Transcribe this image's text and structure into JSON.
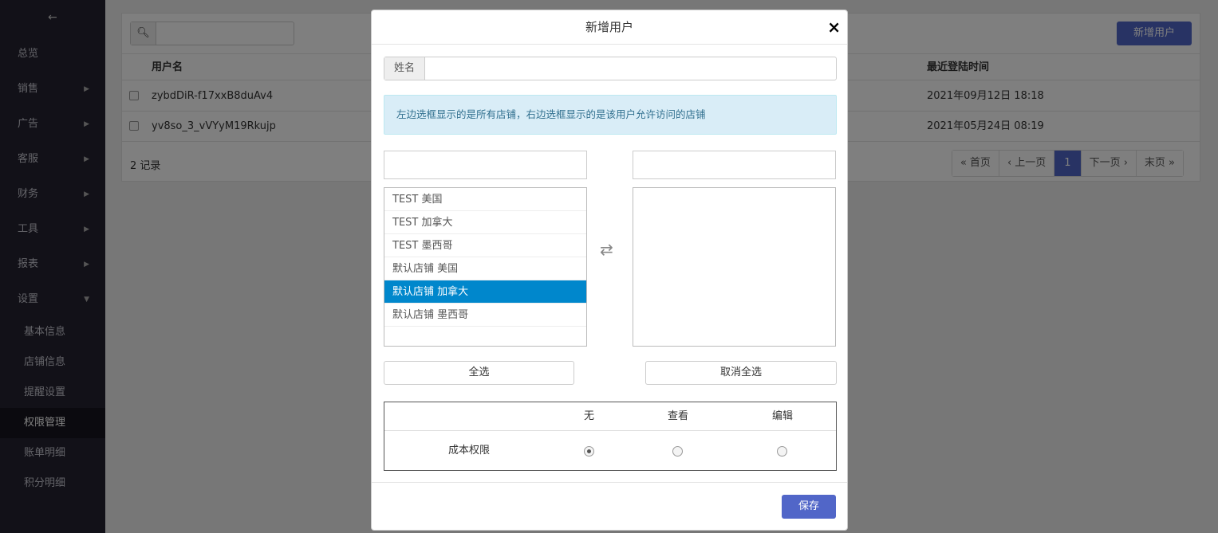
{
  "sidebar": {
    "items": [
      {
        "label": "总览",
        "has_chevron": false
      },
      {
        "label": "销售",
        "has_chevron": true
      },
      {
        "label": "广告",
        "has_chevron": true
      },
      {
        "label": "客服",
        "has_chevron": true
      },
      {
        "label": "财务",
        "has_chevron": true
      },
      {
        "label": "工具",
        "has_chevron": true
      },
      {
        "label": "报表",
        "has_chevron": true
      },
      {
        "label": "设置",
        "has_chevron": true,
        "expanded": true
      }
    ],
    "sub_items": [
      {
        "label": "基本信息"
      },
      {
        "label": "店铺信息"
      },
      {
        "label": "提醒设置"
      },
      {
        "label": "权限管理",
        "active": true
      },
      {
        "label": "账单明细"
      },
      {
        "label": "积分明细"
      }
    ]
  },
  "main": {
    "add_user_label": "新增用户",
    "table": {
      "headers": {
        "username": "用户名",
        "last_login": "最近登陆时间"
      },
      "rows": [
        {
          "username": "zybdDiR-f17xxB8duAv4",
          "last_login": "2021年09月12日 18:18"
        },
        {
          "username": "yv8so_3_vVYyM19Rkujp",
          "last_login": "2021年05月24日 08:19"
        }
      ]
    },
    "records_label": "2 记录",
    "pager": {
      "first": "« 首页",
      "prev": "‹ 上一页",
      "current": "1",
      "next": "下一页 ›",
      "last": "末页 »"
    }
  },
  "modal": {
    "title": "新增用户",
    "close_symbol": "×",
    "name_label": "姓名",
    "name_value": "",
    "info_text": "左边选框显示的是所有店铺，右边选框显示的是该用户允许访问的店铺",
    "left_filter_value": "",
    "right_filter_value": "",
    "left_options": [
      {
        "label": "TEST 美国",
        "selected": false
      },
      {
        "label": "TEST 加拿大",
        "selected": false
      },
      {
        "label": "TEST 墨西哥",
        "selected": false
      },
      {
        "label": "默认店铺 美国",
        "selected": false
      },
      {
        "label": "默认店铺 加拿大",
        "selected": true
      },
      {
        "label": "默认店铺 墨西哥",
        "selected": false
      }
    ],
    "right_options": [],
    "select_all_label": "全选",
    "deselect_all_label": "取消全选",
    "permissions": {
      "columns": [
        "无",
        "查看",
        "编辑"
      ],
      "rows": [
        {
          "label": "成本权限",
          "value": "无"
        }
      ]
    },
    "save_label": "保存"
  },
  "colors": {
    "primary": "#5166c8",
    "selected_option": "#0087cc",
    "sidebar_bg": "#242230",
    "alert_bg": "#d9edf7",
    "alert_text": "#31708f"
  }
}
